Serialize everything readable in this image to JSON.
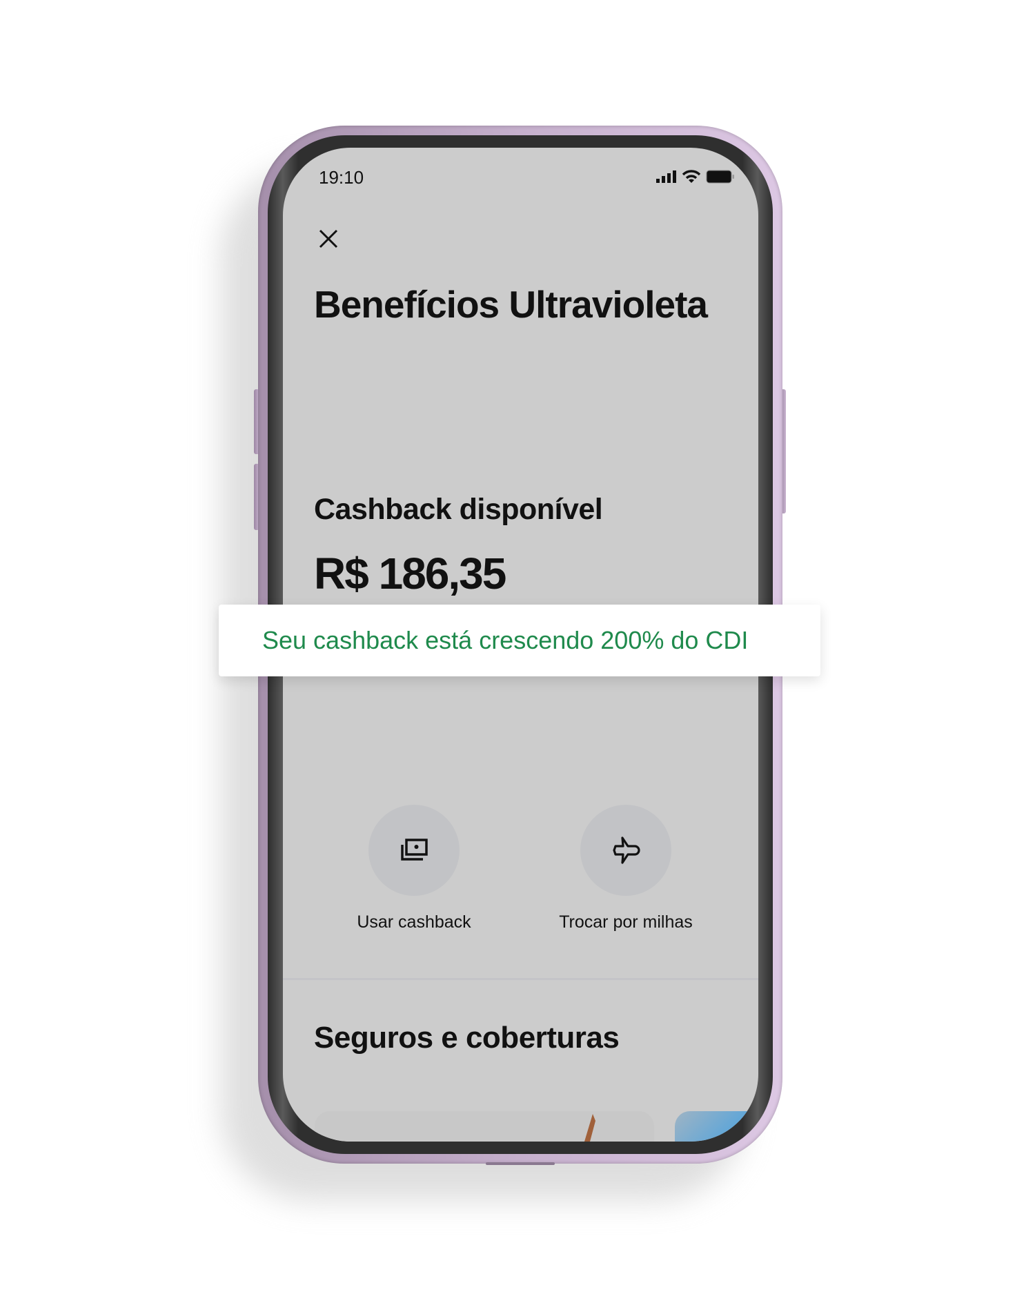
{
  "status_bar": {
    "time": "19:10",
    "icons": [
      "signal-icon",
      "wifi-icon",
      "battery-icon"
    ]
  },
  "header": {
    "close_icon": "close-icon",
    "title": "Benefícios Ultravioleta"
  },
  "cashback": {
    "label": "Cashback disponível",
    "amount": "R$ 186,35"
  },
  "banner": {
    "text": "Seu cashback está crescendo 200% do CDI",
    "color": "#1f8a4c"
  },
  "actions": [
    {
      "label": "Usar cashback",
      "icon": "cash-stack-icon"
    },
    {
      "label": "Trocar por milhas",
      "icon": "airplane-icon"
    }
  ],
  "section": {
    "title": "Seguros e coberturas"
  },
  "colors": {
    "frame": "#b9a2c0",
    "screen_bg": "#cccccc"
  }
}
